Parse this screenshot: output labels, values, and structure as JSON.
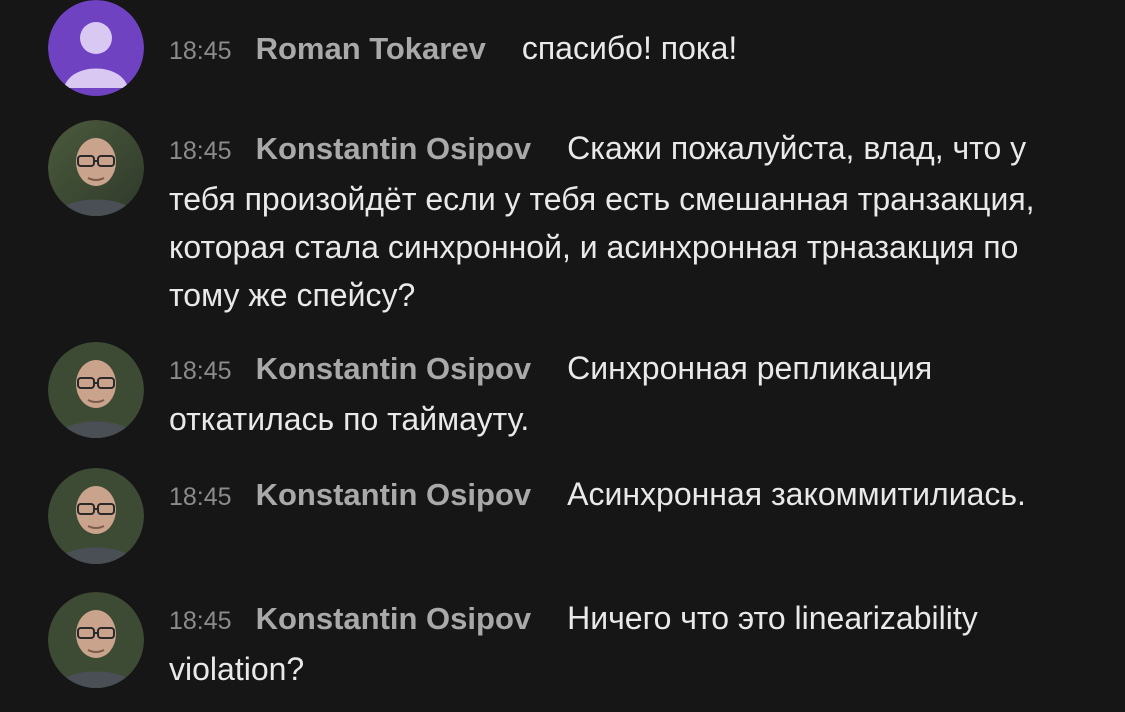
{
  "messages": [
    {
      "time": "18:45",
      "author": "Roman Tokarev",
      "text": "спасибо! пока!",
      "avatar": "default-user"
    },
    {
      "time": "18:45",
      "author": "Konstantin Osipov",
      "text": "Скажи пожалуйста, влад, что у тебя произойдёт если у тебя есть смешанная транзакция, которая стала синхронной, и асинхронная трназакция по тому же спейсу?",
      "avatar": "photo"
    },
    {
      "time": "18:45",
      "author": "Konstantin Osipov",
      "text": "Синхронная репликация откатилась по таймауту.",
      "avatar": "photo"
    },
    {
      "time": "18:45",
      "author": "Konstantin Osipov",
      "text": "Асинхронная закоммитилиась.",
      "avatar": "photo"
    },
    {
      "time": "18:45",
      "author": "Konstantin Osipov",
      "text": "Ничего что это linearizability violation?",
      "avatar": "photo"
    }
  ],
  "colors": {
    "background": "#171617",
    "time": "#8b8b8b",
    "author": "#a9a9a9",
    "text": "#e9e9e9",
    "default_avatar": "#6f42c1"
  }
}
